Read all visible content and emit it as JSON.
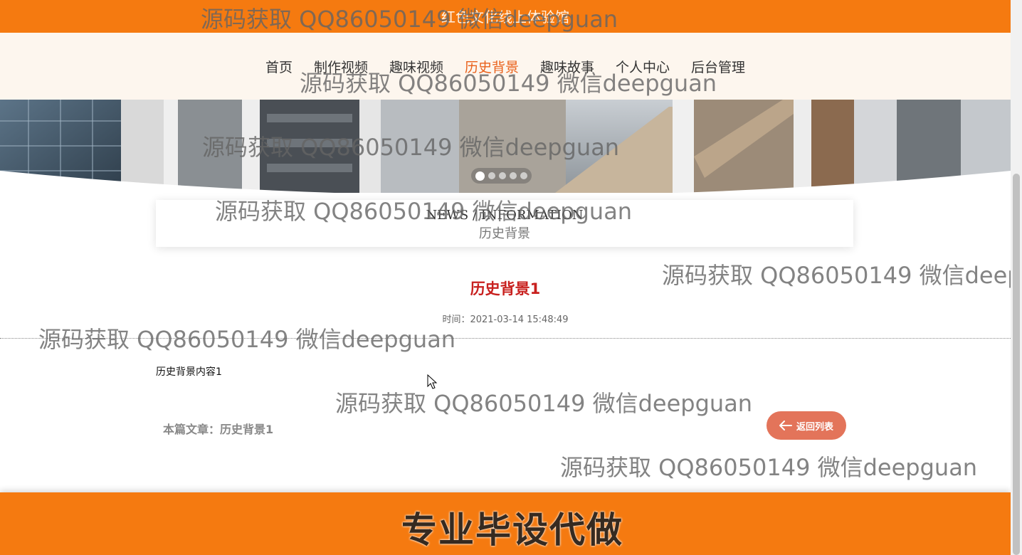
{
  "site": {
    "title": "红色文化线上体验馆"
  },
  "nav": [
    {
      "label": "首页"
    },
    {
      "label": "制作视频"
    },
    {
      "label": "趣味视频"
    },
    {
      "label": "历史背景",
      "active": true
    },
    {
      "label": "趣味故事"
    },
    {
      "label": "个人中心"
    },
    {
      "label": "后台管理"
    }
  ],
  "carousel": {
    "slides": 5,
    "active_index": 0
  },
  "section": {
    "en": "NEWS / INFORMATION",
    "cn": "历史背景"
  },
  "article": {
    "title": "历史背景1",
    "time": "时间：2021-03-14 15:48:49",
    "body": "历史背景内容1",
    "current": "本篇文章：历史背景1",
    "back_label": "返回列表"
  },
  "footer": {
    "big_text": "专业毕设代做"
  },
  "watermark": "源码获取 QQ86050149 微信deepguan",
  "colors": {
    "accent": "#f57a10",
    "title_red": "#c8201e",
    "button": "#e3745a"
  }
}
